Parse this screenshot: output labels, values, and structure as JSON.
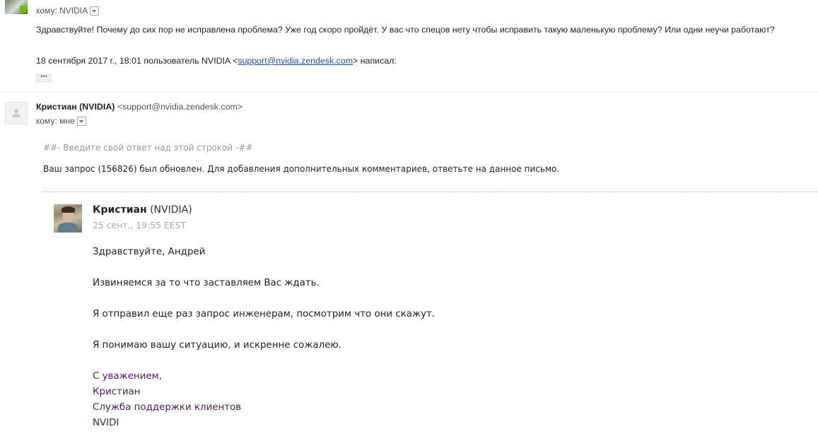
{
  "message1": {
    "to_label": "кому: NVIDIA",
    "body": "Здравствуйте! Почему до сих пор не исправлена проблема? Уже год скоро пройдёт. У вас что спецов нету чтобы исправить такую маленькую проблему? Или одни неучи работают?",
    "quote_header_prefix": "18 сентября 2017 г., 18:01 пользователь NVIDIA <",
    "quote_header_email": "support@nvidia.zendesk.com",
    "quote_header_suffix": "> написал:",
    "show_trimmed": "•••"
  },
  "message2": {
    "sender_name": "Кристиан (NVIDIA)",
    "sender_email": "<support@nvidia.zendesk.com>",
    "to_label": "кому: мне",
    "reply_marker": "##- Введите свой ответ над этой строкой -##",
    "request_text": "Ваш запрос (156826) был обновлен. Для добавления дополнительных комментариев, ответьте на данное письмо.",
    "comment": {
      "author_name": "Кристиан",
      "author_org": "(NVIDIA)",
      "timestamp": "25 сент., 19:55 EEST",
      "lines": [
        "Здравствуйте, Андрей",
        "Извиняемся за то что заставляем Вас ждать.",
        "Я отправил еще раз запрос инженерам, посмотрим что они скажут.",
        "Я понимаю вашу ситуацию, и искренне сожалею."
      ],
      "signature": [
        "С уважением,",
        "Кристиан",
        "Служба поддержки клиентов",
        "NVIDI"
      ]
    }
  },
  "colors": {
    "link": "#1a4ec4",
    "signature": "#4a1d52",
    "muted": "#999999"
  }
}
